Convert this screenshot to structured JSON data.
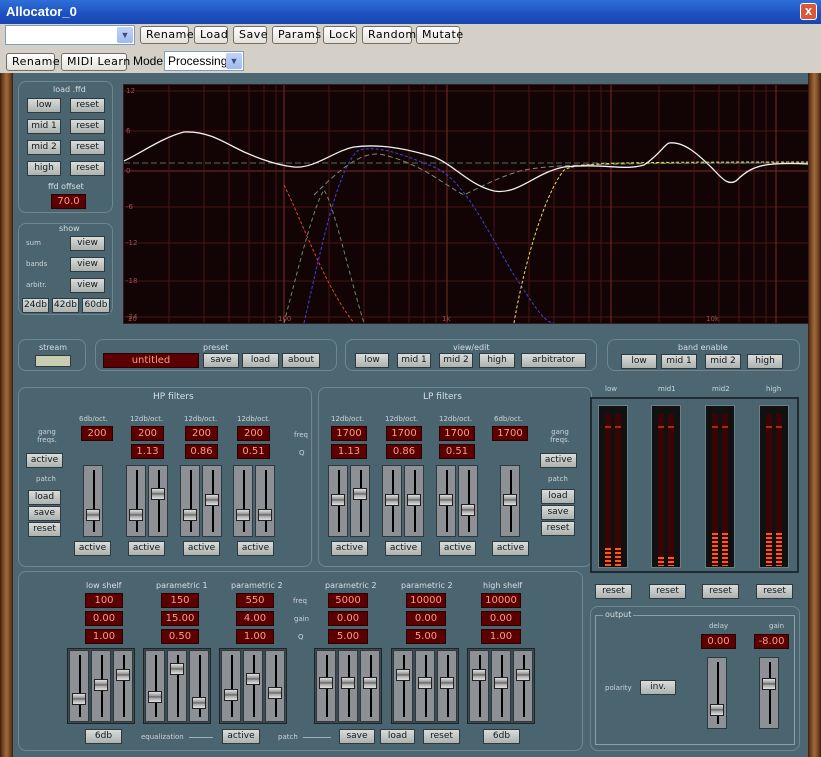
{
  "window": {
    "title": "Allocator_0",
    "close": "x"
  },
  "toolbar1": {
    "preset_value": "",
    "buttons": [
      "Rename",
      "Load",
      "Save",
      "Params",
      "Lock",
      "Random",
      "Mutate"
    ]
  },
  "toolbar2": {
    "rename": "Rename",
    "midi_learn": "MIDI Learn",
    "mode_label": "Mode",
    "mode_value": "Processing"
  },
  "load_ffd": {
    "title": "load .ffd",
    "bands": [
      "low",
      "mid 1",
      "mid 2",
      "high"
    ],
    "reset": "reset",
    "offset_label": "ffd offset",
    "offset_value": "70.0"
  },
  "show": {
    "title": "show",
    "rows": [
      {
        "label": "sum",
        "button": "view"
      },
      {
        "label": "bands",
        "button": "view"
      },
      {
        "label": "arbitr.",
        "button": "view"
      }
    ],
    "ranges": [
      "24db",
      "42db",
      "60db"
    ]
  },
  "graph": {
    "y_ticks": [
      "12",
      "6",
      "0",
      "-6",
      "-12",
      "-18",
      "-24"
    ],
    "x_ticks": [
      "20",
      "100",
      "1k",
      "10k"
    ]
  },
  "stream": {
    "title": "stream"
  },
  "preset": {
    "title": "preset",
    "name": "untitled",
    "save": "save",
    "load": "load",
    "about": "about"
  },
  "view_edit": {
    "title": "view/edit",
    "buttons": [
      "low",
      "mid 1",
      "mid 2",
      "high",
      "arbitrator"
    ]
  },
  "band_enable": {
    "title": "band enable",
    "buttons": [
      "low",
      "mid 1",
      "mid 2",
      "high"
    ]
  },
  "hp": {
    "title": "HP filters",
    "gang_label": "gang freqs.",
    "active": "active",
    "patch_label": "patch",
    "load": "load",
    "save": "save",
    "reset": "reset",
    "columns": [
      {
        "header": "6db/oct.",
        "freq": "200",
        "q": ""
      },
      {
        "header": "12db/oct.",
        "freq": "200",
        "q": "1.13"
      },
      {
        "header": "12db/oct.",
        "freq": "200",
        "q": "0.86"
      },
      {
        "header": "12db/oct.",
        "freq": "200",
        "q": "0.51"
      }
    ]
  },
  "center": {
    "freq": "freq",
    "q": "Q"
  },
  "lp": {
    "title": "LP filters",
    "gang_label": "gang freqs.",
    "active": "active",
    "patch_label": "patch",
    "load": "load",
    "save": "save",
    "reset": "reset",
    "columns": [
      {
        "header": "12db/oct.",
        "freq": "1700",
        "q": "1.13"
      },
      {
        "header": "12db/oct.",
        "freq": "1700",
        "q": "0.86"
      },
      {
        "header": "12db/oct.",
        "freq": "1700",
        "q": "0.51"
      },
      {
        "header": "6db/oct.",
        "freq": "1700",
        "q": ""
      }
    ]
  },
  "meters": {
    "labels": [
      "low",
      "mid1",
      "mid2",
      "high"
    ],
    "reset": "reset",
    "levels": [
      0.12,
      0.06,
      0.22,
      0.22
    ]
  },
  "eq": {
    "row_labels": [
      "freq",
      "gain",
      "Q"
    ],
    "bands": [
      {
        "title": "low shelf",
        "freq": "100",
        "gain": "0.00",
        "q": "1.00"
      },
      {
        "title": "parametric 1",
        "freq": "150",
        "gain": "15.00",
        "q": "0.50"
      },
      {
        "title": "parametric 2",
        "freq": "550",
        "gain": "4.00",
        "q": "1.00"
      },
      {
        "title": "parametric 2",
        "freq": "5000",
        "gain": "0.00",
        "q": "5.00"
      },
      {
        "title": "parametric 2",
        "freq": "10000",
        "gain": "0.00",
        "q": "5.00"
      },
      {
        "title": "high shelf",
        "freq": "10000",
        "gain": "0.00",
        "q": "1.00"
      }
    ],
    "left_6db": "6db",
    "right_6db": "6db",
    "equalization_label": "equalization",
    "active": "active",
    "patch_label": "patch",
    "save": "save",
    "load": "load",
    "reset": "reset"
  },
  "output": {
    "title": "output",
    "delay_label": "delay",
    "delay_value": "0.00",
    "gain_label": "gain",
    "gain_value": "-8.00",
    "polarity_label": "polarity",
    "inv": "inv."
  }
}
